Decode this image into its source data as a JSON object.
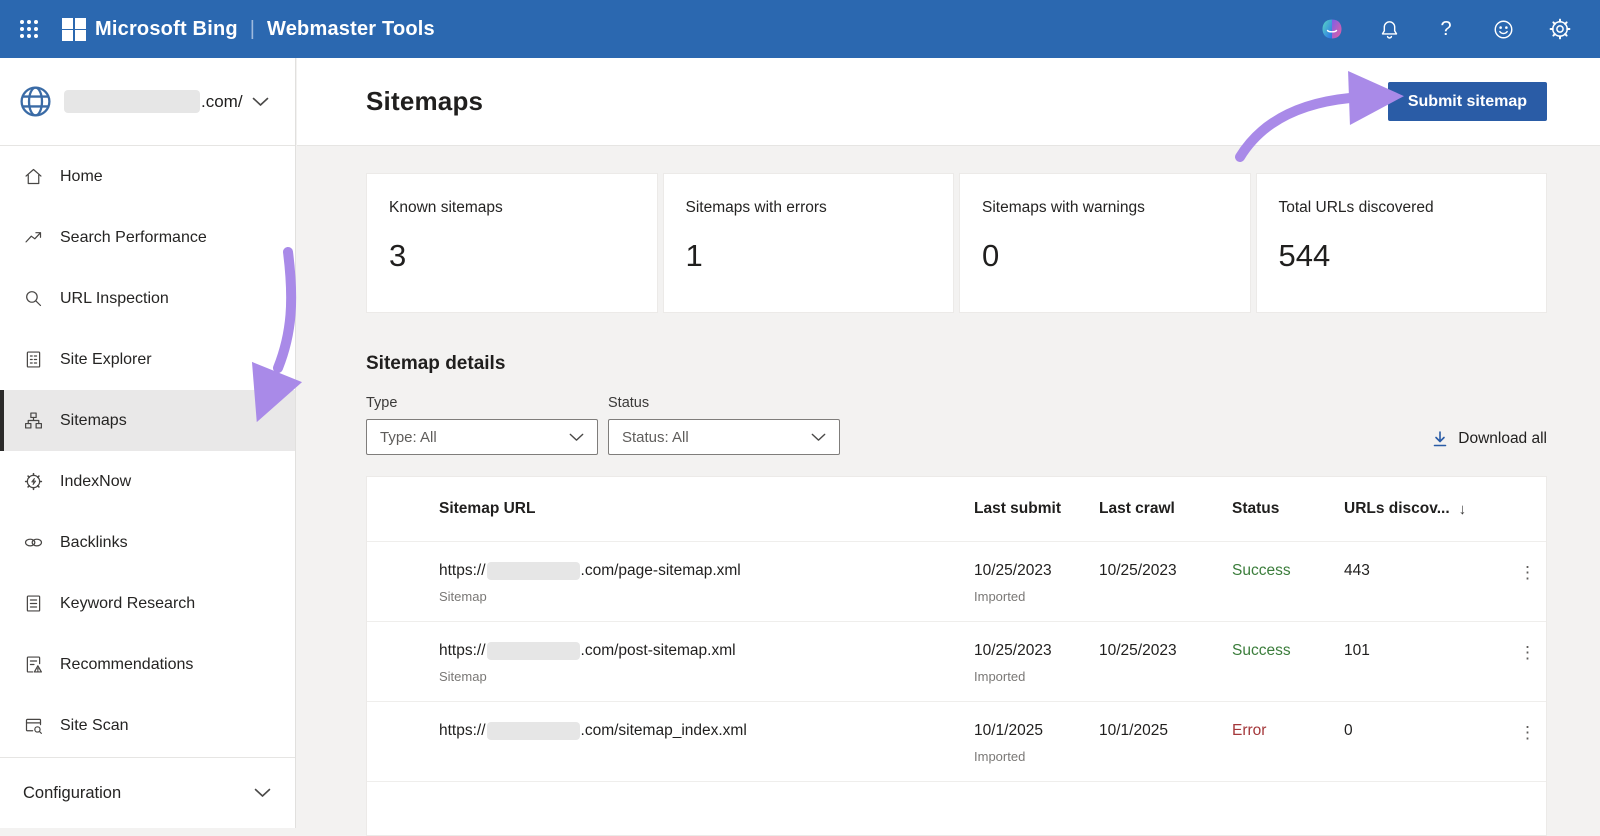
{
  "topbar": {
    "brand": "Microsoft Bing",
    "product": "Webmaster Tools",
    "icons": [
      "waffle-icon",
      "copilot-icon",
      "bell-icon",
      "help-icon",
      "feedback-smiley-icon",
      "settings-gear-icon"
    ],
    "help_glyph": "?"
  },
  "site_selector": {
    "domain_suffix": ".com/",
    "icon": "globe-icon"
  },
  "sidebar": {
    "items": [
      {
        "label": "Home",
        "icon": "home-icon"
      },
      {
        "label": "Search Performance",
        "icon": "trend-up-icon"
      },
      {
        "label": "URL Inspection",
        "icon": "magnifier-icon"
      },
      {
        "label": "Site Explorer",
        "icon": "document-list-icon"
      },
      {
        "label": "Sitemaps",
        "icon": "org-chart-icon",
        "selected": true
      },
      {
        "label": "IndexNow",
        "icon": "gear-bolt-icon"
      },
      {
        "label": "Backlinks",
        "icon": "chain-link-icon"
      },
      {
        "label": "Keyword Research",
        "icon": "document-lines-icon"
      },
      {
        "label": "Recommendations",
        "icon": "document-warning-icon"
      },
      {
        "label": "Site Scan",
        "icon": "browser-scan-icon"
      }
    ],
    "config": {
      "label": "Configuration"
    }
  },
  "header": {
    "title": "Sitemaps",
    "submit_label": "Submit sitemap"
  },
  "stats": [
    {
      "label": "Known sitemaps",
      "value": "3"
    },
    {
      "label": "Sitemaps with errors",
      "value": "1"
    },
    {
      "label": "Sitemaps with warnings",
      "value": "0"
    },
    {
      "label": "Total URLs discovered",
      "value": "544"
    }
  ],
  "details": {
    "title": "Sitemap details",
    "type_filter": {
      "label": "Type",
      "value": "Type: All"
    },
    "status_filter": {
      "label": "Status",
      "value": "Status: All"
    },
    "download_label": "Download all"
  },
  "table": {
    "columns": [
      "Sitemap URL",
      "Last submit",
      "Last crawl",
      "Status",
      "URLs discov...",
      "sort-descending-icon"
    ],
    "kebab_glyph": "⋮",
    "sort_glyph": "↓",
    "rows": [
      {
        "url_prefix": "https://",
        "url_redacted": true,
        "url_suffix": ".com/page-sitemap.xml",
        "type": "Sitemap",
        "last_submit": "10/25/2023",
        "submit_note": "Imported",
        "last_crawl": "10/25/2023",
        "status": "Success",
        "urls_discovered": "443"
      },
      {
        "url_prefix": "https://",
        "url_redacted": true,
        "url_suffix": ".com/post-sitemap.xml",
        "type": "Sitemap",
        "last_submit": "10/25/2023",
        "submit_note": "Imported",
        "last_crawl": "10/25/2023",
        "status": "Success",
        "urls_discovered": "101"
      },
      {
        "url_prefix": "https://",
        "url_redacted": true,
        "url_suffix": ".com/sitemap_index.xml",
        "type": "",
        "last_submit": "10/1/2025",
        "submit_note": "Imported",
        "last_crawl": "10/1/2025",
        "status": "Error",
        "urls_discovered": "0"
      }
    ]
  },
  "colors": {
    "topbar_blue": "#2b68b0",
    "button_blue": "#2a5ca6",
    "annotation_purple": "#a98ae8",
    "success_green": "#3b7d3b",
    "error_red": "#a4373a",
    "selected_item_bg": "#e9e8e8"
  }
}
